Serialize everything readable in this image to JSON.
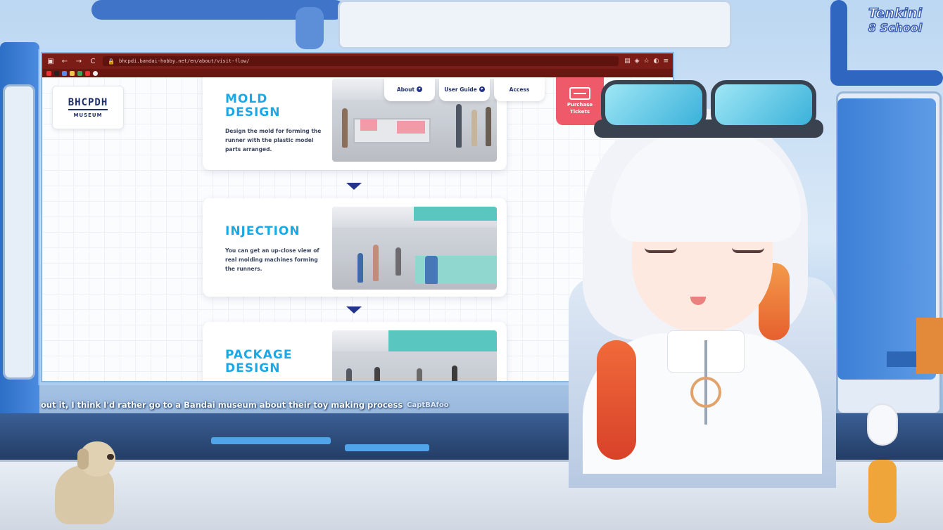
{
  "browser": {
    "url": "bhcpdi.bandai-hobby.net/en/about/visit-flow/",
    "nav": {
      "back": "←",
      "forward": "→",
      "reload": "C"
    },
    "toolbar_icons": [
      "reader-icon",
      "shield-icon",
      "star-icon",
      "extensions-icon",
      "menu-icon"
    ]
  },
  "site": {
    "logo": {
      "mark": "BHCPDH",
      "sub": "MUSEUM"
    },
    "nav_tabs": [
      {
        "label": "About",
        "has_chevron": true
      },
      {
        "label": "User Guide",
        "has_chevron": true
      },
      {
        "label": "Access",
        "has_chevron": false
      }
    ],
    "purchase": {
      "label_1": "Purchase",
      "label_2": "Tickets"
    },
    "steps": [
      {
        "title_1": "MOLD",
        "title_2": "DESIGN",
        "desc_1": "Design the mold for forming the",
        "desc_2": "runner with the plastic model",
        "desc_3": "parts arranged."
      },
      {
        "title_1": "INJECTION",
        "title_2": "",
        "desc_1": "You can get an up-close view of",
        "desc_2": "real molding machines forming",
        "desc_3": "the runners."
      },
      {
        "title_1": "PACKAGE",
        "title_2": "DESIGN",
        "desc_1": "",
        "desc_2": "",
        "desc_3": ""
      }
    ]
  },
  "chat": {
    "message": "out it, I think I'd rather go to a Bandai museum about their toy making process",
    "next_user": "CaptBAfoo"
  },
  "stream_logo": {
    "line_1": "Tenkini",
    "line_2": "8 School"
  },
  "colors": {
    "browser_bar": "#7b1d16",
    "step_title": "#1aa9e6",
    "arrow": "#23348a",
    "purchase": "#ef5a6a"
  }
}
